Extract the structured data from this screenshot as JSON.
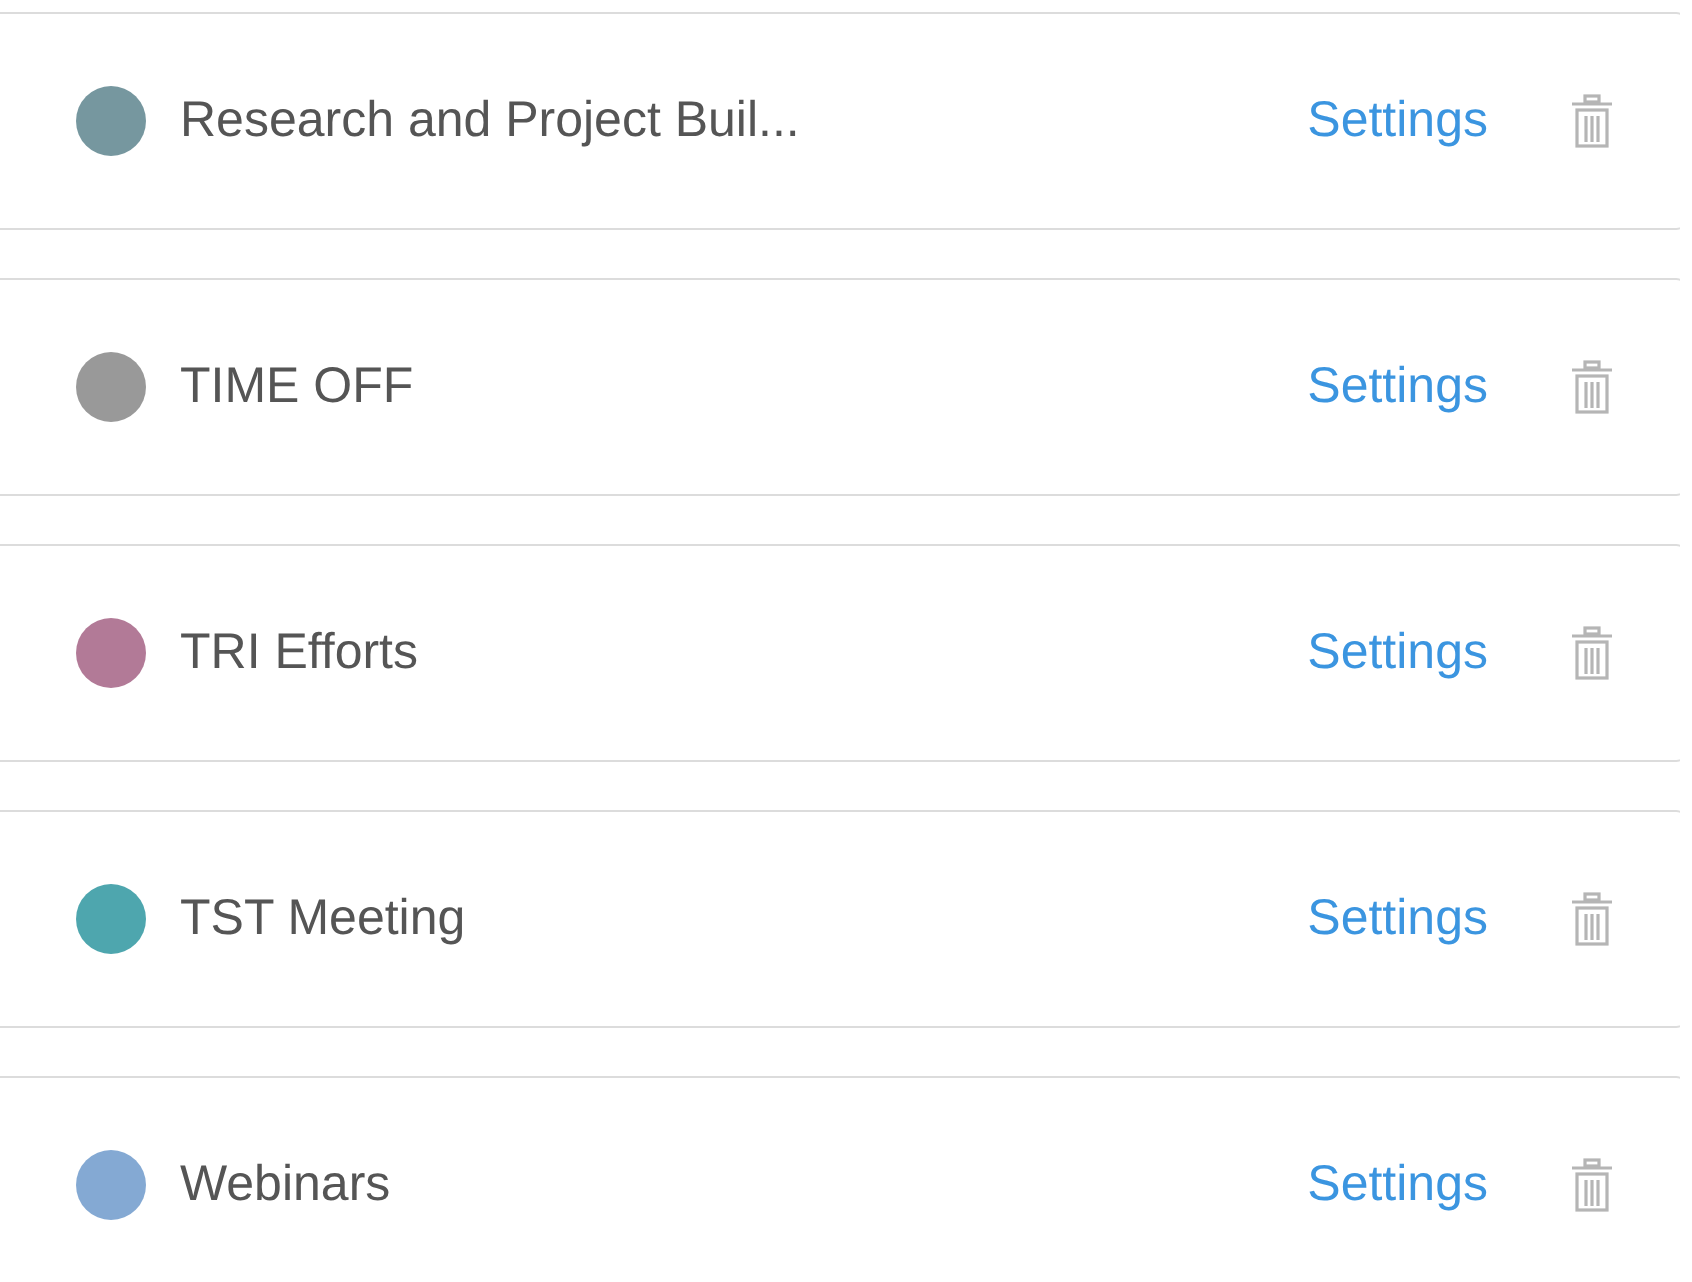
{
  "calendars": [
    {
      "name": "Research and Project Buil...",
      "color": "#76979f",
      "action": "Settings"
    },
    {
      "name": "TIME OFF",
      "color": "#999999",
      "action": "Settings"
    },
    {
      "name": "TRI Efforts",
      "color": "#b27a97",
      "action": "Settings"
    },
    {
      "name": "TST Meeting",
      "color": "#4ea6ae",
      "action": "Settings"
    },
    {
      "name": "Webinars",
      "color": "#84a9d3",
      "action": "Settings"
    }
  ]
}
